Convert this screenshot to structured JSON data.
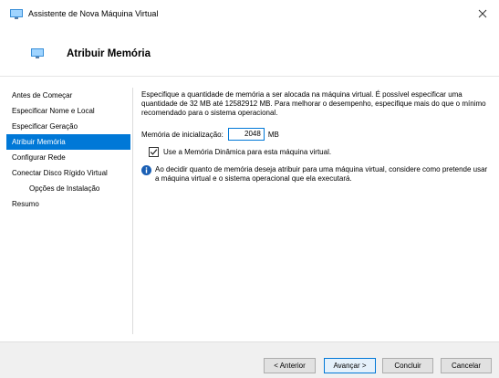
{
  "window": {
    "title": "Assistente de Nova Máquina Virtual",
    "close_icon": "close-icon",
    "app_icon": "monitor-icon"
  },
  "header": {
    "title": "Atribuir Memória",
    "icon": "monitor-icon"
  },
  "nav": {
    "items": [
      {
        "label": "Antes de Começar",
        "active": false,
        "indent": false
      },
      {
        "label": "Especificar Nome e Local",
        "active": false,
        "indent": false
      },
      {
        "label": "Especificar Geração",
        "active": false,
        "indent": false
      },
      {
        "label": "Atribuir Memória",
        "active": true,
        "indent": false
      },
      {
        "label": "Configurar Rede",
        "active": false,
        "indent": false
      },
      {
        "label": "Conectar Disco Rígido Virtual",
        "active": false,
        "indent": false
      },
      {
        "label": "Opções de Instalação",
        "active": false,
        "indent": true
      },
      {
        "label": "Resumo",
        "active": false,
        "indent": false
      }
    ]
  },
  "content": {
    "description": "Especifique a quantidade de memória a ser alocada na máquina virtual. É possível especificar uma quantidade de 32 MB até 12582912 MB. Para melhorar o desempenho, especifique mais do que o mínimo recomendado para o sistema operacional.",
    "memory_label": "Memória de inicialização:",
    "memory_value": "2048",
    "memory_unit": "MB",
    "dynamic_memory_label": "Use a Memória Dinâmica para esta máquina virtual.",
    "dynamic_memory_checked": true,
    "info_text": "Ao decidir quanto de memória deseja atribuir para uma máquina virtual, considere como pretende usar a máquina virtual e o sistema operacional que ela executará.",
    "info_icon": "info-icon"
  },
  "footer": {
    "back_label": "< Anterior",
    "next_label": "Avançar >",
    "finish_label": "Concluir",
    "cancel_label": "Cancelar"
  },
  "colors": {
    "accent": "#0078d7",
    "footer_bg": "#f0f0f0"
  }
}
